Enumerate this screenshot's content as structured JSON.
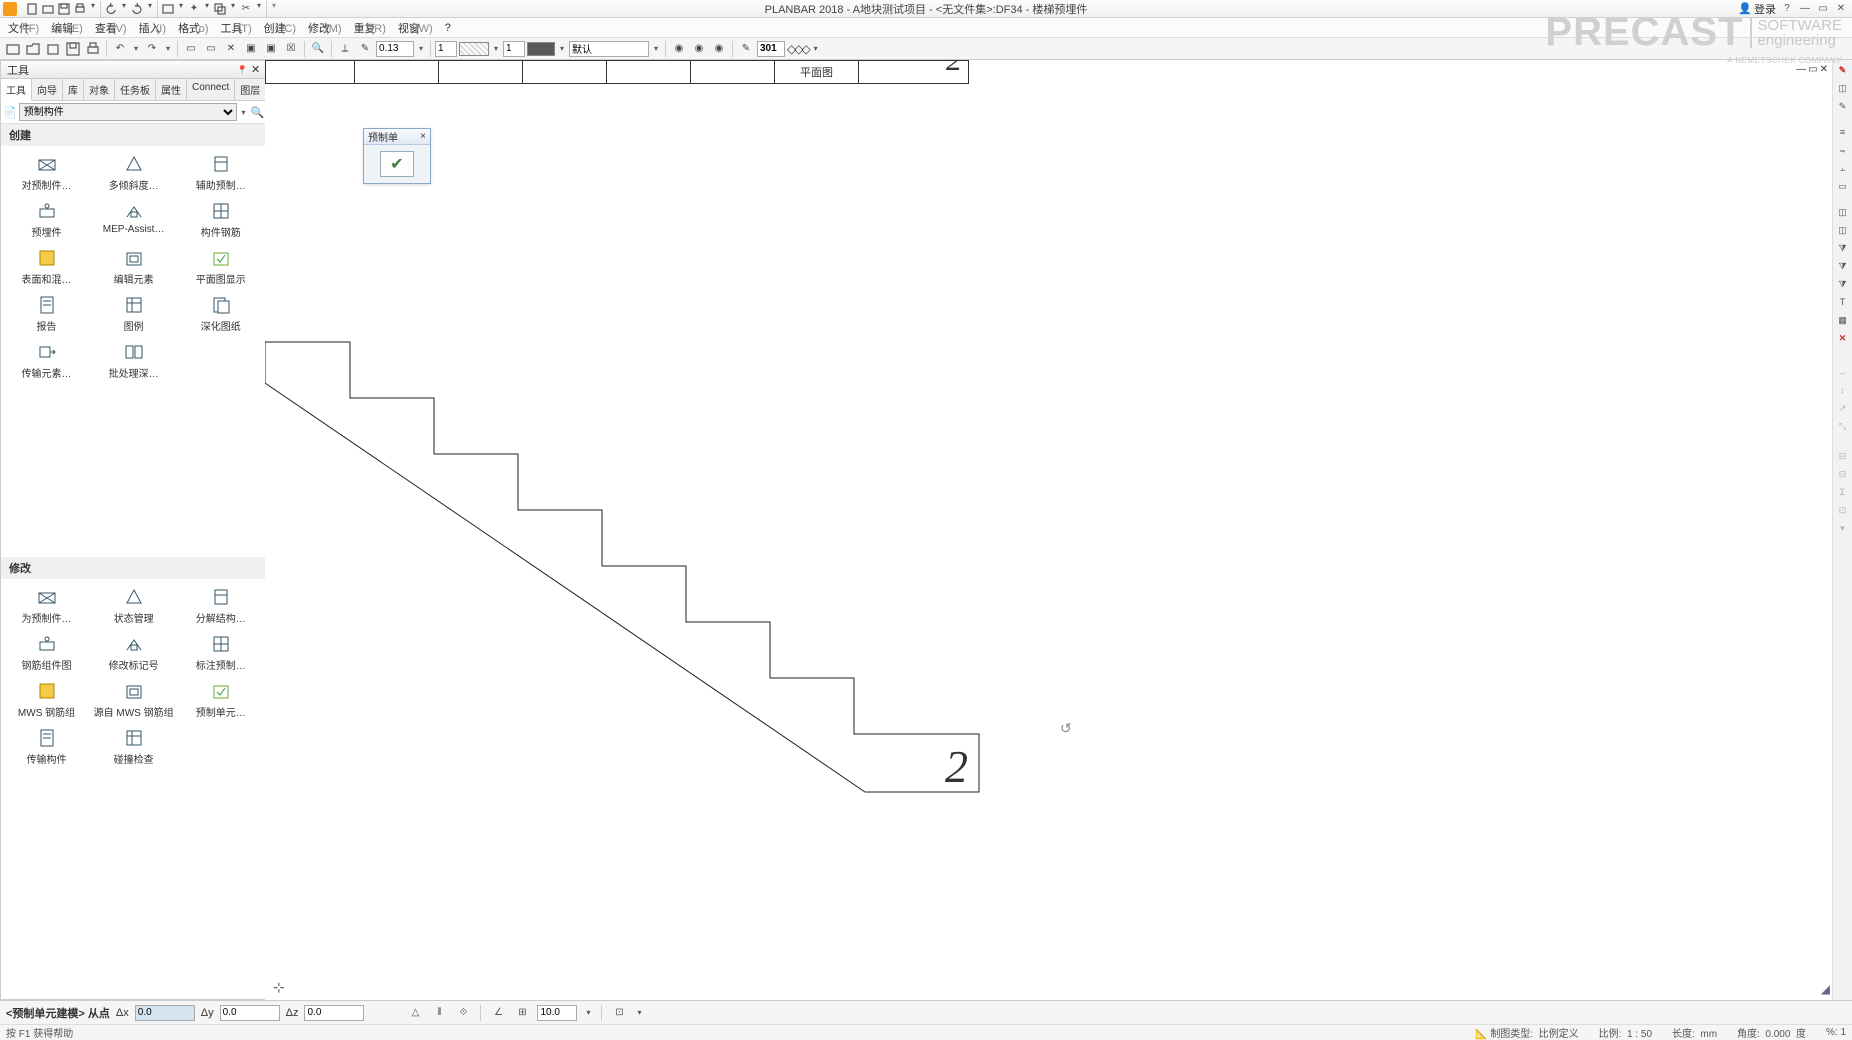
{
  "title": "PLANBAR 2018 - A地块测试项目 - <无文件集>:DF34 - 楼梯预埋件",
  "login": "登录",
  "watermark": {
    "pre": "PRECAST",
    "soft1": "SOFTWARE",
    "soft2": "engineering",
    "sub": "A NEMETSCHEK COMPANY"
  },
  "menus": [
    {
      "l": "文件",
      "h": "(F)"
    },
    {
      "l": "编辑",
      "h": "(E)"
    },
    {
      "l": "查看",
      "h": "(V)"
    },
    {
      "l": "插入",
      "h": "(I)"
    },
    {
      "l": "格式",
      "h": "(o)"
    },
    {
      "l": "工具",
      "h": "(T)"
    },
    {
      "l": "创建",
      "h": "(C)"
    },
    {
      "l": "修改",
      "h": "(M)"
    },
    {
      "l": "重复",
      "h": "(R)"
    },
    {
      "l": "视窗",
      "h": "(W)"
    },
    {
      "l": "?",
      "h": ""
    }
  ],
  "toolbar_vals": {
    "thick": "0.13",
    "layer_num1": "1",
    "layer_num2": "1",
    "layer_name": "默认",
    "pen": "301"
  },
  "left": {
    "title": "工具",
    "tabs": [
      "工具",
      "向导",
      "库",
      "对象",
      "任务板",
      "属性",
      "Connect",
      "图层"
    ],
    "combo": "预制构件",
    "create_head": "创建",
    "create_items": [
      "对预制件…",
      "多倾斜度…",
      "辅助预制…",
      "预埋件",
      "MEP-Assist…",
      "构件钢筋",
      "表面和混…",
      "编辑元素",
      "平面图显示",
      "报告",
      "图例",
      "深化图纸",
      "传输元素…",
      "批处理深…"
    ],
    "modify_head": "修改",
    "modify_items": [
      "为预制件…",
      "状态管理",
      "分解结构…",
      "钢筋组件图",
      "修改标记号",
      "标注预制…",
      "MWS 钢筋组",
      "源自 MWS 钢筋组",
      "预制单元…",
      "传输构件",
      "碰撞检查"
    ]
  },
  "float": {
    "title": "预制单",
    "close": "×"
  },
  "canvas": {
    "plan_label": "平面图",
    "big2": "2"
  },
  "coord": {
    "prefix": "<预制单元建模>  从点",
    "dx_label": "Δx",
    "dx": "0.0",
    "dy_label": "Δy",
    "dy": "0.0",
    "dz_label": "Δz",
    "dz": "0.0",
    "grid1": "10.0"
  },
  "status": {
    "help": "按 F1 获得帮助",
    "drawtype_l": "制图类型:",
    "drawtype_v": "比例定义",
    "scale_l": "比例:",
    "scale_v": "1 : 50",
    "len_l": "长度:",
    "len_v": "mm",
    "ang_l": "角度:",
    "ang_v": "0.000",
    "ang_u": "度",
    "pct_l": "%:",
    "pct_v": "1"
  }
}
